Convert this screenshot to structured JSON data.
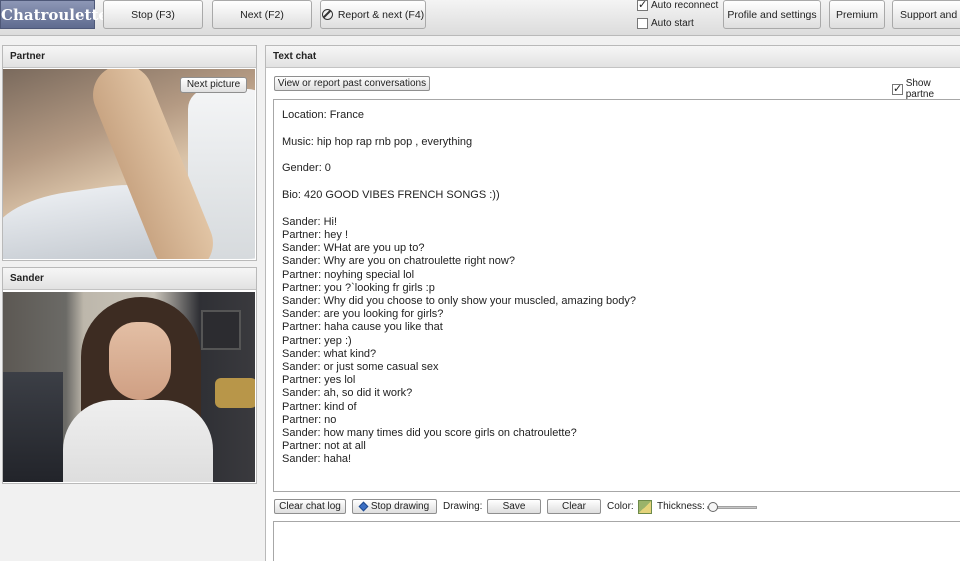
{
  "topbar": {
    "logo": "Chatroulette",
    "stop_label": "Stop (F3)",
    "next_label": "Next (F2)",
    "report_next_label": "Report & next (F4)",
    "auto_reconnect_label": "Auto reconnect",
    "auto_reconnect_checked": true,
    "auto_start_label": "Auto start",
    "auto_start_checked": false,
    "profile_label": "Profile and settings",
    "premium_label": "Premium",
    "support_label": "Support and o"
  },
  "partner_panel": {
    "title": "Partner",
    "next_picture_label": "Next picture"
  },
  "self_panel": {
    "title": "Sander"
  },
  "chat_panel": {
    "title": "Text chat",
    "past_conversations_label": "View or report past conversations",
    "show_partner_label": "Show partne",
    "show_partner_checked": true,
    "info": [
      "Location: France",
      "Music: hip hop rap rnb pop , everything",
      "Gender: 0",
      "Bio: 420 GOOD VIBES FRENCH SONGS :))"
    ],
    "messages": [
      "Sander: Hi!",
      "Partner: hey !",
      "Sander: WHat are you up to?",
      "Sander: Why are you on chatroulette right now?",
      "Partner: noyhing special lol",
      "Partner: you ?`looking fr girls :p",
      "Sander: Why did you choose to only show your muscled, amazing body?",
      "Sander: are you looking for girls?",
      "Partner: haha cause you like that",
      "Partner: yep :)",
      "Sander: what kind?",
      "Sander: or just some casual sex",
      "Partner: yes lol",
      "Sander: ah, so did it work?",
      "Partner: kind of",
      "Partner: no",
      "Sander: how many times did you score girls on chatroulette?",
      "Partner: not at all",
      "Sander: haha!"
    ],
    "toolbar": {
      "clear_log_label": "Clear chat log",
      "stop_drawing_label": "Stop drawing",
      "drawing_label": "Drawing:",
      "save_label": "Save",
      "clear_label": "Clear",
      "color_label": "Color:",
      "thickness_label": "Thickness:"
    }
  }
}
